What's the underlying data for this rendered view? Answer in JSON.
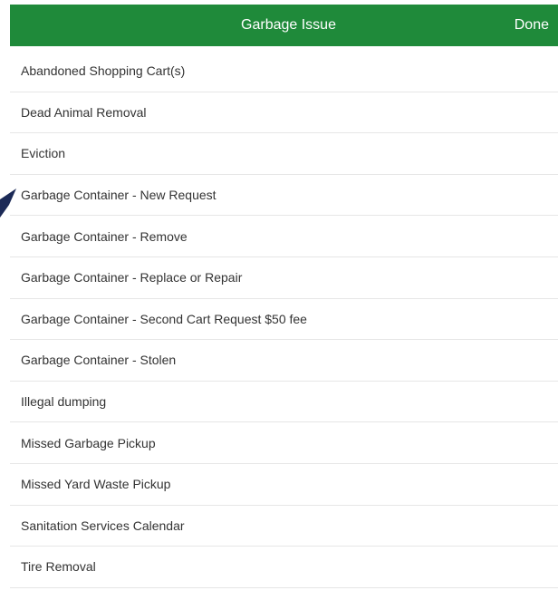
{
  "header": {
    "title": "Garbage Issue",
    "done_label": "Done"
  },
  "colors": {
    "header_background": "#1f8a3a",
    "header_text": "#ffffff",
    "item_text": "#333333",
    "divider": "#e6e6e6",
    "pointer": "#1c2a57"
  },
  "items": [
    {
      "label": "Abandoned Shopping Cart(s)"
    },
    {
      "label": "Dead Animal Removal"
    },
    {
      "label": "Eviction"
    },
    {
      "label": "Garbage Container - New Request"
    },
    {
      "label": "Garbage Container - Remove"
    },
    {
      "label": "Garbage Container - Replace or Repair"
    },
    {
      "label": "Garbage Container - Second Cart Request $50 fee"
    },
    {
      "label": "Garbage Container - Stolen"
    },
    {
      "label": "Illegal dumping"
    },
    {
      "label": "Missed Garbage Pickup"
    },
    {
      "label": "Missed Yard Waste Pickup"
    },
    {
      "label": "Sanitation Services Calendar"
    },
    {
      "label": "Tire Removal"
    }
  ],
  "pointer_icon": "arrow-pointer-icon"
}
